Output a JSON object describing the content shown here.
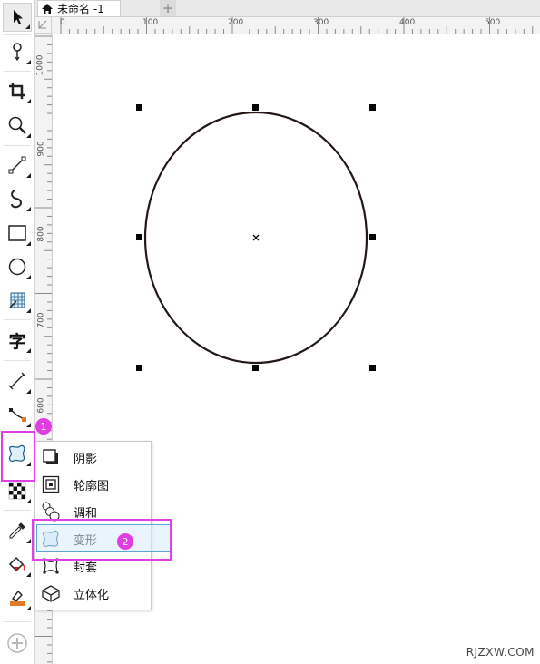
{
  "document_tab": {
    "title": "未命名 -1",
    "add_tab_symbol": "+"
  },
  "ruler_top": {
    "labels": [
      "0",
      "100",
      "200",
      "300",
      "400",
      "500"
    ]
  },
  "ruler_left": {
    "labels": [
      "1000",
      "900",
      "800",
      "700",
      "600"
    ]
  },
  "toolbar": {
    "tools": [
      "pick-tool-icon",
      "freehand-shape-tool-icon",
      "crop-tool-icon",
      "zoom-tool-icon",
      "line-tool-icon",
      "artistic-media-tool-icon",
      "rectangle-tool-icon",
      "ellipse-tool-icon",
      "graph-paper-tool-icon",
      "text-tool-icon",
      "dimension-tool-icon",
      "connector-tool-icon",
      "effects-tool-icon",
      "transparency-tool-icon",
      "eyedropper-tool-icon",
      "interactive-fill-tool-icon",
      "smart-fill-tool-icon",
      "add-tool-icon"
    ],
    "text_tool_glyph": "字",
    "add_glyph": "+"
  },
  "flyout_menu": {
    "items": [
      {
        "label": "阴影",
        "icon": "drop-shadow-icon"
      },
      {
        "label": "轮廓图",
        "icon": "contour-icon"
      },
      {
        "label": "调和",
        "icon": "blend-icon"
      },
      {
        "label": "变形",
        "icon": "distort-icon",
        "selected": true
      },
      {
        "label": "封套",
        "icon": "envelope-icon"
      },
      {
        "label": "立体化",
        "icon": "extrude-icon"
      }
    ]
  },
  "annotations": {
    "step_1": "1",
    "step_2": "2",
    "highlight_color": "#e040e6"
  },
  "watermark": "RJZXW.COM",
  "colors": {
    "ellipse_stroke": "#231815",
    "selection_accent": "#5aa5d8",
    "badge": "#e03ee0"
  }
}
